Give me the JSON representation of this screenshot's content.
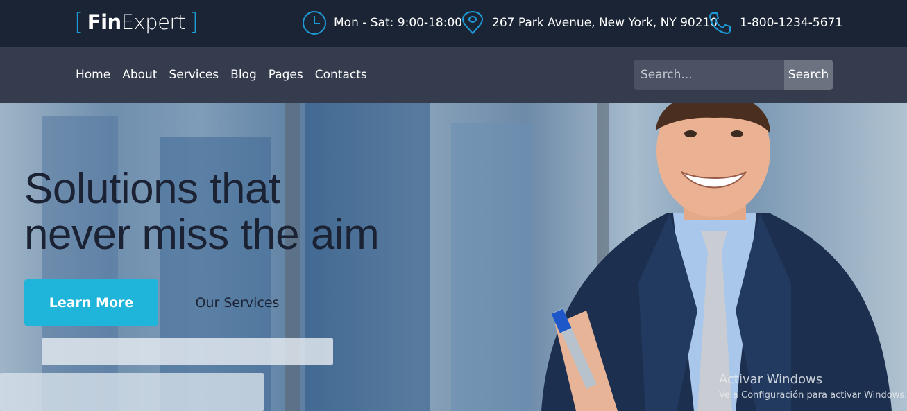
{
  "brand": {
    "bracket_left": "[",
    "fin": "Fin",
    "expert": "Expert",
    "bracket_right": "]"
  },
  "topbar": {
    "hours": "Mon - Sat: 9:00-18:00",
    "address": "267 Park Avenue, New York, NY 90210",
    "phone": "1-800-1234-5671",
    "icons": [
      "clock-icon",
      "map-pin-icon",
      "phone-icon"
    ],
    "accent": "#1d9bd7"
  },
  "nav": {
    "items": [
      {
        "label": "Home"
      },
      {
        "label": "About"
      },
      {
        "label": "Services"
      },
      {
        "label": "Blog"
      },
      {
        "label": "Pages"
      },
      {
        "label": "Contacts"
      }
    ]
  },
  "search": {
    "placeholder": "Search...",
    "button": "Search"
  },
  "hero": {
    "title_line1": "Solutions that",
    "title_line2": "never miss the aim",
    "primary_button": "Learn More",
    "secondary_button": "Our Services",
    "button_color": "#1fb5da"
  },
  "watermark": {
    "line1": "Activar Windows",
    "line2": "Ve a Configuración para activar Windows."
  }
}
